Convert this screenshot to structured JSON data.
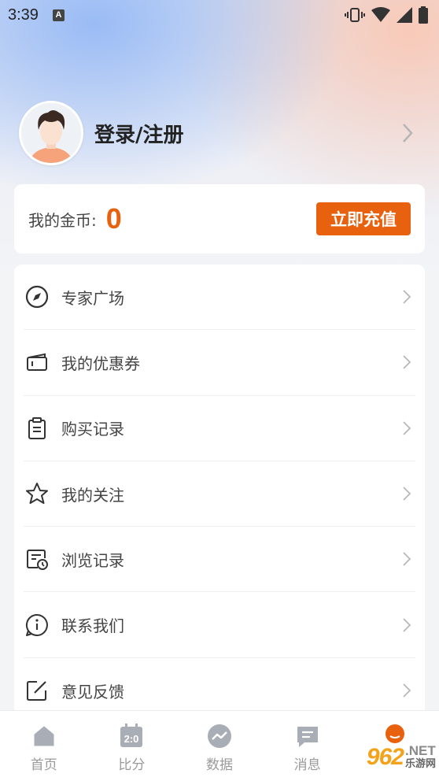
{
  "status_bar": {
    "time": "3:39",
    "notification_letter": "A"
  },
  "profile": {
    "login_text": "登录/注册"
  },
  "coins": {
    "label": "我的金币:",
    "value": "0",
    "recharge_label": "立即充值"
  },
  "menu": {
    "items": [
      {
        "label": "专家广场",
        "icon": "compass-icon"
      },
      {
        "label": "我的优惠券",
        "icon": "coupon-icon"
      },
      {
        "label": "购买记录",
        "icon": "clipboard-icon"
      },
      {
        "label": "我的关注",
        "icon": "star-icon"
      },
      {
        "label": "浏览记录",
        "icon": "history-icon"
      },
      {
        "label": "联系我们",
        "icon": "info-icon"
      },
      {
        "label": "意见反馈",
        "icon": "edit-icon"
      }
    ]
  },
  "tabbar": {
    "items": [
      {
        "label": "首页",
        "icon": "home-icon"
      },
      {
        "label": "比分",
        "icon": "scoreboard-icon",
        "icon_text": "2:0"
      },
      {
        "label": "数据",
        "icon": "chart-icon"
      },
      {
        "label": "消息",
        "icon": "message-icon"
      },
      {
        "label": "",
        "icon": "profile-icon"
      }
    ]
  },
  "watermark": {
    "number": "962",
    "net": ".NET",
    "site": "乐游网"
  },
  "colors": {
    "accent": "#e8610f",
    "text_primary": "#222222",
    "text_secondary": "#444444",
    "tab_inactive": "#9a9a9a"
  }
}
